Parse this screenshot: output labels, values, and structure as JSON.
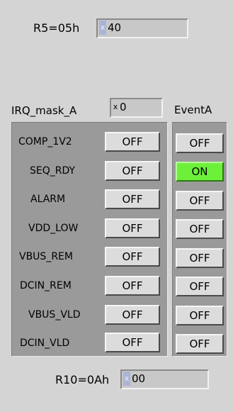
{
  "r5": {
    "label": "R5=05h",
    "radix": "x",
    "value": "40"
  },
  "irq": {
    "label": "IRQ_mask_A",
    "radix": "x",
    "value": "0"
  },
  "event": {
    "header": "EventA"
  },
  "signals": [
    {
      "label": "COMP_1V2",
      "mask": "OFF",
      "event": "OFF"
    },
    {
      "label": "SEQ_RDY",
      "mask": "OFF",
      "event": "ON"
    },
    {
      "label": "ALARM",
      "mask": "OFF",
      "event": "OFF"
    },
    {
      "label": "VDD_LOW",
      "mask": "OFF",
      "event": "OFF"
    },
    {
      "label": "VBUS_REM",
      "mask": "OFF",
      "event": "OFF"
    },
    {
      "label": "DCIN_REM",
      "mask": "OFF",
      "event": "OFF"
    },
    {
      "label": "VBUS_VLD",
      "mask": "OFF",
      "event": "OFF"
    },
    {
      "label": "DCIN_VLD",
      "mask": "OFF",
      "event": "OFF"
    }
  ],
  "r10": {
    "label": "R10=0Ah",
    "radix": "x",
    "value": "00"
  },
  "colors": {
    "background": "#d4d4d4",
    "panel": "#9a9a9a",
    "button": "#dcdcdc",
    "on_indicator": "#6df03a"
  }
}
